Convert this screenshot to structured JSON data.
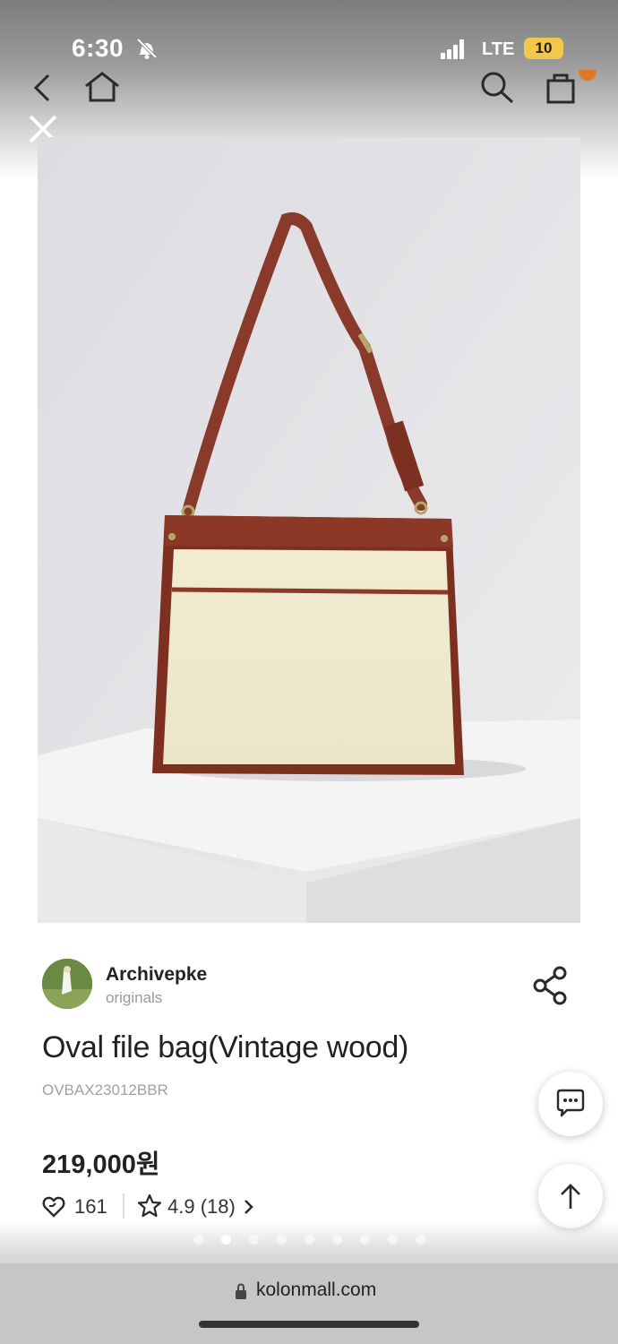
{
  "status_bar": {
    "time": "6:30",
    "network": "LTE",
    "battery": "10"
  },
  "nav": {
    "icons": [
      "back-chevron-icon",
      "home-icon",
      "search-icon",
      "cart-icon"
    ],
    "accent_color": "#e0782b"
  },
  "product_image": {
    "description_icon": "bag-photo",
    "current_slide": 2,
    "total_slides": 9
  },
  "brand": {
    "name": "Archivepke",
    "subtitle": "originals"
  },
  "product": {
    "title": "Oval file bag(Vintage wood)",
    "sku": "OVBAX23012BBR",
    "price": "219,000원",
    "likes": "161",
    "rating": "4.9 (18)"
  },
  "browser": {
    "url": "kolonmall.com"
  }
}
